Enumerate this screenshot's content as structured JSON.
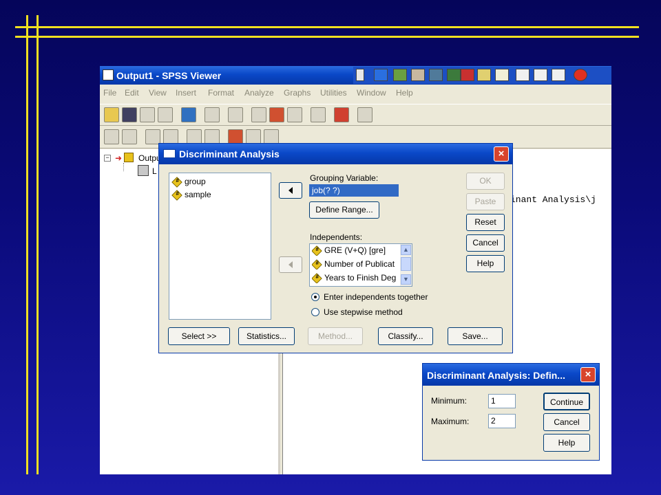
{
  "viewer": {
    "title": "Output1 - SPSS Viewer",
    "menu": [
      "File",
      "Edit",
      "View",
      "Insert",
      "Format",
      "Analyze",
      "Graphs",
      "Utilities",
      "Window",
      "Help"
    ],
    "tree_root_label": "Outpu",
    "tree_child_label": "L",
    "content_text": "inant Analysis\\j"
  },
  "discriminant": {
    "title": "Discriminant Analysis",
    "source_variables": [
      "group",
      "sample"
    ],
    "grouping_label": "Grouping Variable:",
    "grouping_value": "job(? ?)",
    "define_range_label": "Define Range...",
    "independents_label": "Independents:",
    "independents": [
      "GRE (V+Q) [gre]",
      "Number of Publicat",
      "Years to Finish Deg"
    ],
    "radio_together": "Enter independents together",
    "radio_stepwise": "Use stepwise method",
    "side_buttons": {
      "ok": "OK",
      "paste": "Paste",
      "reset": "Reset",
      "cancel": "Cancel",
      "help": "Help"
    },
    "bottom_buttons": {
      "select": "Select >>",
      "statistics": "Statistics...",
      "method": "Method...",
      "classify": "Classify...",
      "save": "Save..."
    }
  },
  "define_range": {
    "title": "Discriminant Analysis: Defin...",
    "minimum_label": "Minimum:",
    "minimum_value": "1",
    "maximum_label": "Maximum:",
    "maximum_value": "2",
    "continue_label": "Continue",
    "cancel_label": "Cancel",
    "help_label": "Help"
  },
  "colors": {
    "background": "#0a0a78",
    "accent_lines": "#f0e020",
    "titlebar": "#0a48c8",
    "selection": "#316ac5"
  }
}
